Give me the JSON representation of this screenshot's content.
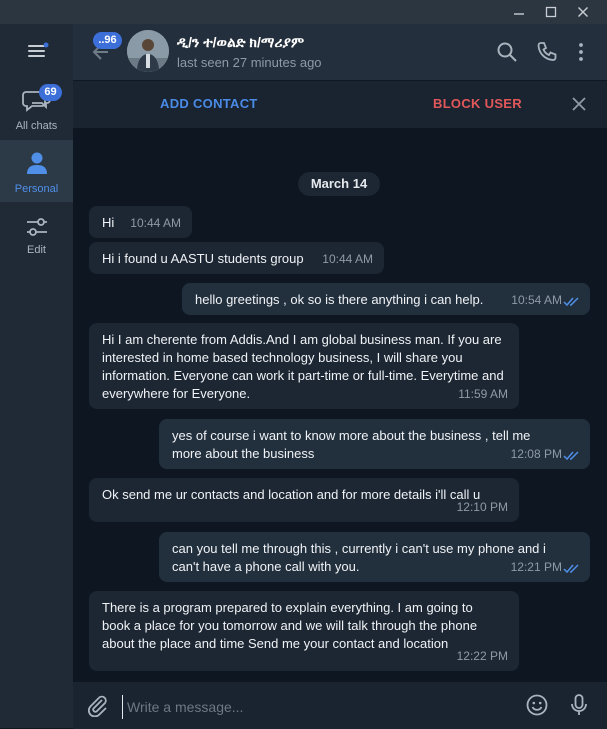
{
  "window": {
    "minimize_icon": "minimize-icon",
    "maximize_icon": "maximize-icon",
    "close_icon": "close-icon"
  },
  "sidebar": {
    "menu_icon": "hamburger-menu-icon",
    "items": [
      {
        "label": "All chats",
        "icon": "chat-bubbles-icon",
        "badge": "69"
      },
      {
        "label": "Personal",
        "icon": "person-icon"
      },
      {
        "label": "Edit",
        "icon": "sliders-icon"
      }
    ]
  },
  "header": {
    "back_badge": "..96",
    "title": "ዲ/ን ተ/ወልድ ክ/ማሪያም",
    "status": "last seen 27 minutes ago"
  },
  "actions": {
    "add_contact": "ADD CONTACT",
    "block_user": "BLOCK USER"
  },
  "chat": {
    "date": "March 14",
    "messages": [
      {
        "dir": "in",
        "text": "Hi",
        "time": "10:44 AM"
      },
      {
        "dir": "in",
        "text": "Hi i found u AASTU students group",
        "time": "10:44 AM"
      },
      {
        "dir": "out",
        "text": "hello greetings , ok so is there anything i can help.",
        "time": "10:54 AM"
      },
      {
        "dir": "in",
        "text": "Hi I am cherente from Addis.And I am global business man. If you are interested in home based technology business, I will share you information. Everyone can work it part-time or full-time. Everytime and everywhere for Everyone.",
        "time": "11:59 AM"
      },
      {
        "dir": "out",
        "text": "yes of course i want to know more about the business , tell me more about the business",
        "time": "12:08 PM"
      },
      {
        "dir": "in",
        "text": "Ok send me ur contacts and location and for more details i'll call u",
        "time": "12:10 PM"
      },
      {
        "dir": "out",
        "text": "can you tell me through this , currently i can't use my phone and i can't have a phone call with you.",
        "time": "12:21 PM"
      },
      {
        "dir": "in",
        "text": "There is a program prepared to explain everything. I am going to book a place for you tomorrow and we will talk through the phone about the place and time Send me your contact and location",
        "time": "12:22 PM"
      }
    ]
  },
  "composer": {
    "placeholder": "Write a message..."
  },
  "colors": {
    "accent": "#3d6fd9",
    "block": "#e2585a",
    "add": "#4a8be6",
    "read_check": "#4f8fe8"
  }
}
